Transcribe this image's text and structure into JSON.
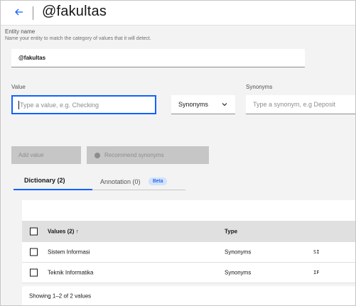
{
  "header": {
    "title": "@fakultas",
    "back_icon": "arrow-left-icon"
  },
  "entity": {
    "label": "Entity name",
    "helper": "Name your entity to match the category of values that it will detect.",
    "value": "@fakultas"
  },
  "value_section": {
    "value_label": "Value",
    "value_placeholder": "Type a value, e.g. Checking",
    "type_dropdown": "Synonyms",
    "synonyms_label": "Synonyms",
    "synonyms_placeholder": "Type a synonym, e.g Deposit"
  },
  "buttons": {
    "add_value": "Add value",
    "recommend": "Recommend synonyms"
  },
  "tabs": [
    {
      "label": "Dictionary (2)"
    },
    {
      "label": "Annotation (0)",
      "badge": "Beta"
    }
  ],
  "table": {
    "headers": {
      "values": "Values (2) ↑",
      "type": "Type"
    },
    "rows": [
      {
        "value": "Sistem Informasi",
        "type": "Synonyms",
        "synonym": "SI"
      },
      {
        "value": "Teknik Informatika",
        "type": "Synonyms",
        "synonym": "IF"
      }
    ],
    "footer": "Showing 1–2 of 2 values"
  },
  "colors": {
    "accent": "#0f62fe",
    "badge_bg": "#d0e2ff",
    "badge_fg": "#0043ce"
  }
}
